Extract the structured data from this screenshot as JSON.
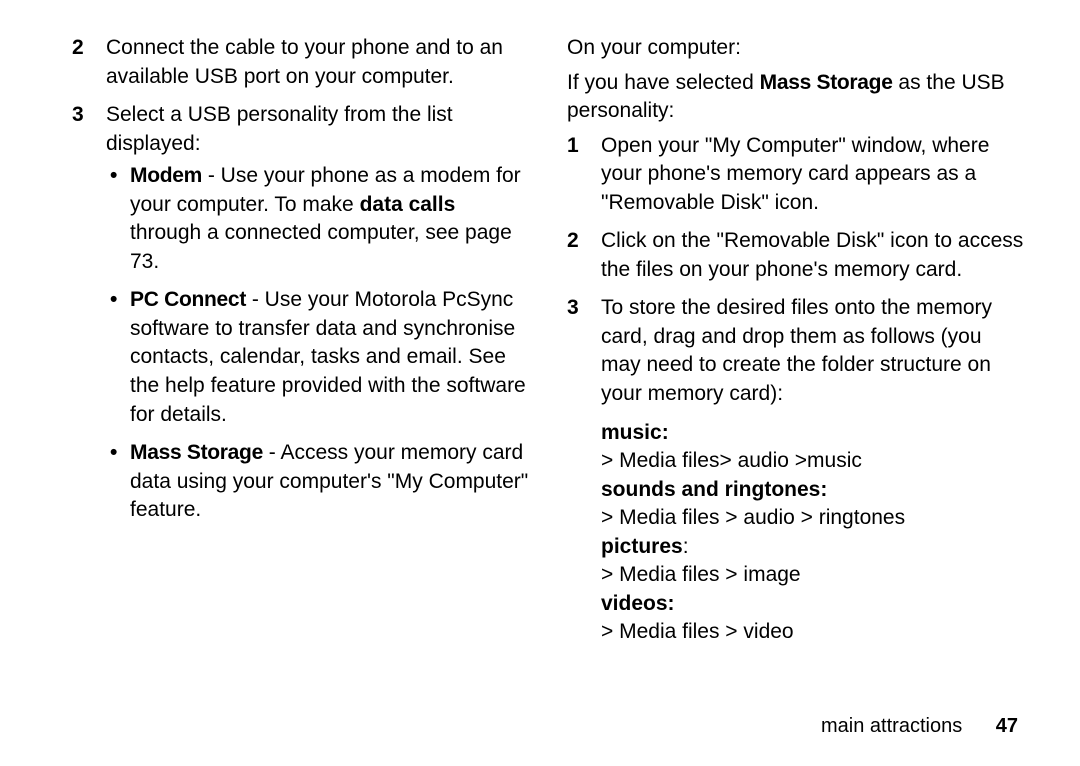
{
  "left": {
    "steps": [
      {
        "n": "2",
        "text": "Connect the cable to your phone and to an available USB port on your computer."
      },
      {
        "n": "3",
        "text": "Select a USB personality from the list displayed:"
      }
    ],
    "bullets": {
      "modem": {
        "name": "Modem",
        "t1": " - Use your phone as a modem for your computer. To make ",
        "bold": "data calls",
        "t2": " through a connected computer, see page 73."
      },
      "pcconnect": {
        "name": "PC Connect",
        "text": " - Use your Motorola PcSync software to transfer data and synchronise contacts, calendar, tasks and email. See the help feature provided with the software for details."
      },
      "mass": {
        "name": "Mass Storage",
        "text": " - Access your memory card data using your computer's \"My Computer\" feature."
      }
    }
  },
  "right": {
    "heading": "On your computer:",
    "intro": {
      "pre": "If you have selected ",
      "mass": "Mass Storage",
      "post": " as the USB personality:"
    },
    "steps": [
      {
        "n": "1",
        "text": "Open your \"My Computer\" window, where your phone's memory card appears as a \"Removable Disk\" icon."
      },
      {
        "n": "2",
        "text": "Click on the \"Removable Disk\" icon to access the files on your phone's memory card."
      },
      {
        "n": "3",
        "text": "To store the desired files onto the memory card, drag and drop them as follows (you may need to create the folder structure on your memory card):"
      }
    ],
    "paths": {
      "music_label": "music:",
      "music_path": "> Media files> audio >music",
      "sounds_label": "sounds and ringtones:",
      "sounds_path": "> Media files > audio > ringtones",
      "pictures_label": "pictures",
      "pictures_suffix": ":",
      "pictures_path": "> Media files > image",
      "videos_label": "videos:",
      "videos_path": "> Media files > video"
    }
  },
  "footer": {
    "section": "main attractions",
    "page": "47"
  }
}
